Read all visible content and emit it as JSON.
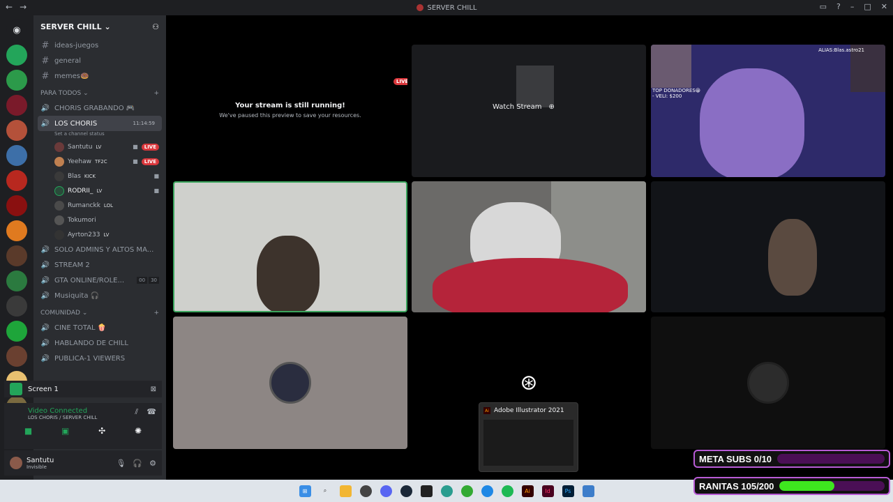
{
  "window": {
    "title": "SERVER CHILL"
  },
  "server": {
    "name": "SERVER CHILL"
  },
  "channels": {
    "text": [
      "ideas-juegos",
      "general",
      "memes🍩"
    ],
    "category_1": "PARA TODOS",
    "voice_1": "CHORIS GRABANDO 🎮",
    "active_channel": "LOS CHORIS",
    "active_timer": "11:14:59",
    "active_status": "Set a channel status",
    "users": [
      {
        "name": "Santutu",
        "tag": "LV",
        "live": "LIVE"
      },
      {
        "name": "Yeehaw",
        "tag": "TF2C",
        "live": "LIVE"
      },
      {
        "name": "Blas",
        "tag": "KICK",
        "live": ""
      },
      {
        "name": "RODRII_",
        "tag": "LV",
        "live": ""
      },
      {
        "name": "Rumanckk",
        "tag": "LOL",
        "live": ""
      },
      {
        "name": "Tokumori",
        "tag": "",
        "live": ""
      },
      {
        "name": "Ayrton233",
        "tag": "LV",
        "live": ""
      }
    ],
    "voice_rest": [
      "SOLO ADMINS Y ALTOS MA...",
      "STREAM 2",
      "GTA ONLINE/ROLE...",
      "Musiquita 🎧"
    ],
    "gta_counts": [
      "00",
      "30"
    ],
    "category_2": "COMUNIDAD",
    "voice_community": [
      "CINE TOTAL 🍿",
      "HABLANDO DE CHILL",
      "PUBLICA-1 VIEWERS"
    ]
  },
  "screen_panel": {
    "label": "Screen 1"
  },
  "voice_panel": {
    "title": "Video Connected",
    "subtitle": "LOS CHORIS / SERVER CHILL"
  },
  "me": {
    "name": "Santutu",
    "status": "Invisible"
  },
  "stage": {
    "live_badge": "LIVE",
    "paused_title": "Your stream is still running!",
    "paused_sub": "We've paused this preview to save your resources.",
    "watch": "Watch Stream",
    "alias": "ALIAS:Blas.astro21",
    "top_donors": "TOP DONADORES😀",
    "top_donor_entry": "- VELI: $200"
  },
  "popup": {
    "title": "Adobe Illustrator 2021"
  },
  "overlay": {
    "meta_label": "META SUBS 0/10",
    "meta_progress": 0,
    "ranitas_label": "RANITAS 105/200",
    "ranitas_progress": 0.525
  },
  "taskbar": {
    "items": [
      "start",
      "search",
      "files",
      "chrome",
      "discord",
      "steam",
      "epic",
      "edge",
      "spotify",
      "illustrator",
      "indesign",
      "photoshop",
      "app"
    ]
  }
}
